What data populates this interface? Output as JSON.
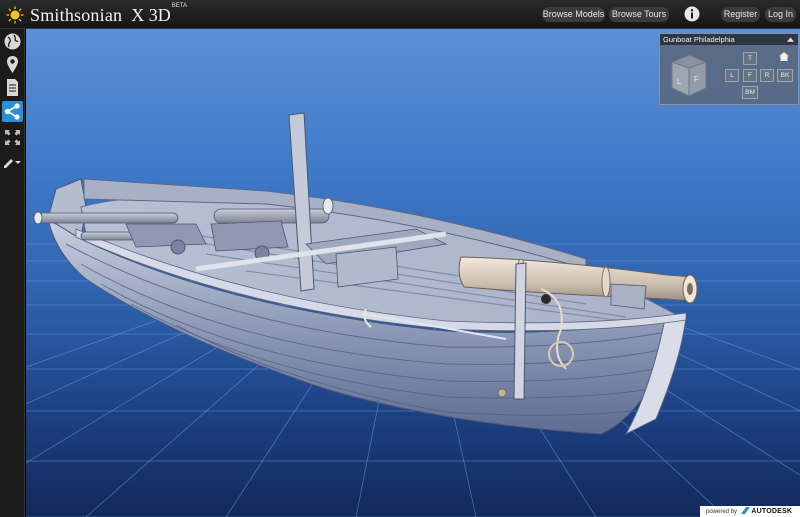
{
  "header": {
    "brand": "Smithsonian",
    "product": "X 3D",
    "beta": "BETA",
    "nav": [
      {
        "label": "Browse Models"
      },
      {
        "label": "Browse Tours"
      },
      {
        "label": "Register"
      },
      {
        "label": "Log In"
      }
    ],
    "icons": {
      "logo": "smithsonian-sun-icon",
      "info": "info-icon"
    }
  },
  "sidebar": {
    "tools": [
      {
        "icon": "globe-icon"
      },
      {
        "icon": "location-pin-icon"
      },
      {
        "icon": "document-icon"
      },
      {
        "icon": "share-icon",
        "active": true
      },
      {
        "icon": "fullscreen-icon"
      },
      {
        "icon": "pencil-dropdown-icon"
      }
    ]
  },
  "viewport": {
    "model_name": "Gunboat Philadelphia",
    "navcube": {
      "cube_faces": [
        "L",
        "F"
      ],
      "buttons": {
        "top": "T",
        "left": "L",
        "front": "F",
        "right": "R",
        "back": "BK",
        "bottom": "BM"
      }
    }
  },
  "footer": {
    "powered_by": "powered by",
    "vendor": "AUTODESK"
  },
  "colors": {
    "accent": "#2a8fd8",
    "sky_top": "#5b90d6",
    "sky_bottom": "#12295a"
  }
}
